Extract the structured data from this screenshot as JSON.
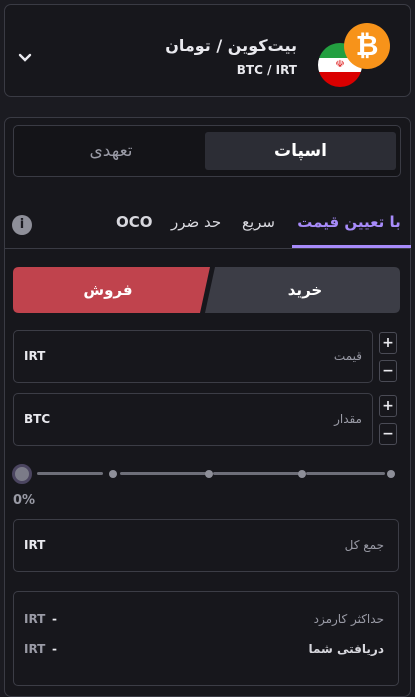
{
  "pair": {
    "title": "بیت‌کوین / تومان",
    "symbol": "BTC / IRT",
    "coin_glyph": "₿",
    "coin_color": "#f7931a",
    "flag_glyph": "☫"
  },
  "market_tabs": {
    "spot": "اسپات",
    "margin": "تعهدی"
  },
  "order_tabs": {
    "limit": "با تعیین قیمت",
    "market": "سریع",
    "stop": "حد ضرر",
    "oco": "OCO",
    "active_color": "#a78bfa"
  },
  "side": {
    "buy": "خرید",
    "sell": "فروش",
    "sell_color": "#c0434d"
  },
  "price": {
    "label": "قیمت",
    "unit": "IRT"
  },
  "amount": {
    "label": "مقدار",
    "unit": "BTC"
  },
  "slider": {
    "value_label": "0%",
    "percent": 0
  },
  "total": {
    "label": "جمع کل",
    "unit": "IRT"
  },
  "summary": {
    "max_fee_label": "حداکثر کارمزد",
    "max_fee_value": "-",
    "max_fee_unit": "IRT",
    "receive_label": "دریافتی شما",
    "receive_value": "-",
    "receive_unit": "IRT"
  },
  "steppers": {
    "plus": "+",
    "minus": "−"
  },
  "info_glyph": "i"
}
